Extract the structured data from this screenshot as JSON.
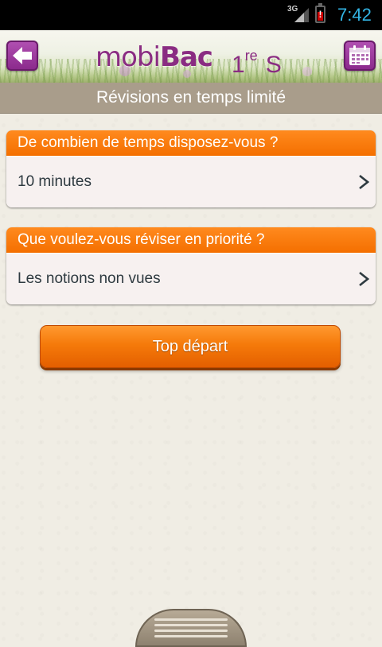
{
  "status_bar": {
    "network": "3G",
    "time": "7:42",
    "battery_alert": "!"
  },
  "header": {
    "logo_light": "mobi",
    "logo_bold": "Bac",
    "level_number": "1",
    "level_sup": "re",
    "level_series": "S"
  },
  "page": {
    "title": "Révisions en temps limité"
  },
  "cards": [
    {
      "header": "De combien de temps disposez-vous ?",
      "value": "10 minutes"
    },
    {
      "header": "Que voulez-vous réviser en priorité ?",
      "value": "Les notions non vues"
    }
  ],
  "start_button": {
    "label": "Top départ"
  },
  "colors": {
    "accent_orange": "#f46f00",
    "brand_purple": "#8a2c82",
    "title_band": "#a99d8b",
    "status_clock": "#33b5e5"
  },
  "icons": {
    "back": "back-arrow-icon",
    "calendar": "calendar-icon",
    "chevron": "chevron-right-icon",
    "drawer": "drawer-handle-icon"
  }
}
